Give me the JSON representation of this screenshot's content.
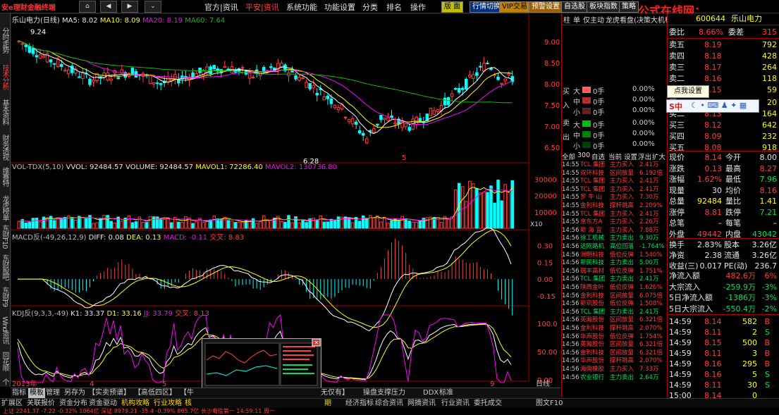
{
  "menu": {
    "logo": "安e理财金融终端",
    "nav_buttons": [
      "⌂",
      "◀",
      "▶",
      "⌄"
    ],
    "items": [
      "官方|资讯",
      "平安|资讯",
      "系统功能",
      "功能设置",
      "分类",
      "排名",
      "操作"
    ],
    "active_item": 1,
    "tool_buttons": [
      "版 面",
      "行情切换",
      "VIP交易",
      "预警设置",
      "自选股",
      "板块指数",
      "策略"
    ],
    "watermark": "公式在线网：www.gszx.com.cn"
  },
  "left_tabs": [
    "分时走势",
    "技术分析",
    "基本资料",
    "财务透视",
    "维赛特",
    "龙虎榜单",
    "东财F10",
    "东财股吧",
    "东财F9",
    "Wind资讯",
    "同花顺",
    "个股"
  ],
  "chart_header": {
    "symbol_title": "乐山电力(日线)",
    "ma5": "MA5: 8.02",
    "ma10": "MA10: 8.09",
    "ma20": "MA20: 8.19",
    "ma60": "MA60: 7.64",
    "price_axis": [
      "9.00",
      "8.50",
      "8.00",
      "7.50",
      "7.00",
      "6.50"
    ],
    "high_label": "9.24",
    "low_label": "6.28",
    "marker": "5"
  },
  "volume_panel": {
    "title": "VOL-TDX(5,10)",
    "vvol": "VVOL: 92484.57",
    "volume": "VOLUME: 92484.57",
    "mavol1": "MAVOL1: 72286.40",
    "mavol2": "MAVOL2: 130736.80",
    "axis": [
      "30000",
      "20000",
      "10000"
    ],
    "unit": "X10"
  },
  "macd_panel": {
    "title": "MACD反(-49,26,12,9)",
    "diff": "DIFF: 0.08",
    "dea": "DEA: 0.13",
    "macd": "MACD: -0.11",
    "cross": "交叉: 8.83",
    "axis": [
      "0.30",
      "0.15",
      "0.00",
      "-0.15"
    ]
  },
  "kdj_panel": {
    "title": "KDJ反(9,3,3,-49)",
    "k": "K1: 33.37",
    "d": "D1: 33.16",
    "jj": "JJ: 33.79",
    "cross": "交叉: 8.13",
    "axis": [
      "100.0",
      "50.00",
      "0.00"
    ]
  },
  "date_axis": {
    "labels": [
      "2013年",
      "4",
      "5",
      "9"
    ],
    "period_label": "日线"
  },
  "bottom_tabs": [
    "指标",
    "模板",
    "管理",
    "另存为",
    "【实卖预谱】",
    "【高低四区】",
    "【牛",
    "无仅有】",
    "操盘支撑压力",
    "DDX",
    "标准"
  ],
  "bottom_tab_active": 1,
  "bottom_bar": [
    "扩展区",
    "关联报价",
    "资金分布",
    "资金驱动",
    "机构攻略",
    "行业攻略",
    "核",
    "期",
    "经济指标",
    "综合资讯",
    "网摘资讯",
    "行业资讯",
    "委托成交",
    "图文F10"
  ],
  "mid_panel": {
    "tabs": [
      "柱",
      "单",
      "仅主动",
      "龙虎看盘(决策大机构)"
    ],
    "buy_label": "买入",
    "sell_label": "卖出",
    "sizes": [
      "大",
      "中",
      "小"
    ],
    "buy_rows": [
      {
        "size": "大",
        "vol": "0手",
        "pct": "0.00%"
      },
      {
        "size": "中",
        "vol": "0手",
        "pct": "0.00%"
      },
      {
        "size": "小",
        "vol": "0手",
        "pct": "0.00%"
      }
    ],
    "sell_rows": [
      {
        "size": "大",
        "vol": "0手",
        "pct": "0.00%"
      },
      {
        "size": "中",
        "vol": "0手",
        "pct": "0.00%"
      },
      {
        "size": "小",
        "vol": "0手",
        "pct": "0.00%"
      }
    ],
    "filter_tabs": [
      "全部",
      "300",
      "自选",
      "当前",
      "设置",
      "浮出",
      "扩大"
    ],
    "trades": [
      {
        "t": "14:55",
        "name": "TCL 集团",
        "act": "主力买入",
        "val": "2.41万",
        "c": "red"
      },
      {
        "t": "14:55",
        "name": "双环科技",
        "act": "区间放量",
        "val": "6.192倍",
        "c": "red"
      },
      {
        "t": "14:55",
        "name": "TCL 集团",
        "act": "主力买入",
        "val": "2.41万",
        "c": "red"
      },
      {
        "t": "14:55",
        "name": "TCL 集团",
        "act": "主力买入",
        "val": "2.41万",
        "c": "red"
      },
      {
        "t": "14:55",
        "name": "罗 牛 山",
        "act": "主力买入",
        "val": "7.30万",
        "c": "red"
      },
      {
        "t": "14:55",
        "name": "金利科技",
        "act": "撑杆跳高",
        "val": "2.209%",
        "c": "red"
      },
      {
        "t": "14:55",
        "name": "TCL 集团",
        "act": "主力买入",
        "val": "2.41万",
        "c": "red"
      },
      {
        "t": "14:55",
        "name": "京东方A",
        "act": "主力买入",
        "val": "2.26万",
        "c": "red"
      },
      {
        "t": "14:56",
        "name": "新 海 宜",
        "act": "主力买入",
        "val": "7.88万",
        "c": "red"
      },
      {
        "t": "14:56",
        "name": "徐工机械",
        "act": "主力卖出",
        "val": "9.30万",
        "c": "green"
      },
      {
        "t": "14:56",
        "name": "达刚路机",
        "act": "高位回落",
        "val": "-1.764%",
        "c": "green"
      },
      {
        "t": "14:56",
        "name": "洲明科技",
        "act": "低位反弹",
        "val": "1.540%",
        "c": "red"
      },
      {
        "t": "14:56",
        "name": "新民科技",
        "act": "主力卖出",
        "val": "5.00万",
        "c": "green"
      },
      {
        "t": "14:56",
        "name": "瑞丰高材",
        "act": "低位反弹",
        "val": "1.751%",
        "c": "red"
      },
      {
        "t": "14:56",
        "name": "TCL 集团",
        "act": "主力卖出",
        "val": "2.41万",
        "c": "green"
      },
      {
        "t": "14:56",
        "name": "陕西金叶",
        "act": "低位反弹",
        "val": "1.626%",
        "c": "red"
      },
      {
        "t": "14:56",
        "name": "金利科技",
        "act": "区间放量",
        "val": "6.075倍",
        "c": "red"
      },
      {
        "t": "14:56",
        "name": "新筑股份",
        "act": "低位反弹",
        "val": "1.508%",
        "c": "red"
      },
      {
        "t": "14:56",
        "name": "TCL 集团",
        "act": "主力卖出",
        "val": "2.41万",
        "c": "green"
      },
      {
        "t": "14:56",
        "name": "英瀚股份",
        "act": "区间放量",
        "val": "6.321倍",
        "c": "red"
      },
      {
        "t": "14:56",
        "name": "金利科技",
        "act": "撑杆跳高",
        "val": "2.070%",
        "c": "red"
      },
      {
        "t": "14:56",
        "name": "华声股份",
        "act": "低位反弹",
        "val": "1.754%",
        "c": "red"
      },
      {
        "t": "14:56",
        "name": "英瀚股份",
        "act": "区间放量",
        "val": "6.321倍",
        "c": "red"
      },
      {
        "t": "14:56",
        "name": "金利科技",
        "act": "区间放量",
        "val": "6.321倍",
        "c": "red"
      },
      {
        "t": "14:56",
        "name": "华声股份",
        "act": "撑杆跳高",
        "val": "2.070%",
        "c": "red"
      },
      {
        "t": "14:56",
        "name": "海南橡胶",
        "act": "主力买入",
        "val": "7.33万",
        "c": "red"
      },
      {
        "t": "14:56",
        "name": "农业银行",
        "act": "主力卖出",
        "val": "2.64万",
        "c": "green"
      }
    ],
    "bottom_tabs": [
      "主力",
      "分布",
      "龙虎",
      "风向"
    ]
  },
  "quote": {
    "code": "600644",
    "name": "乐山电力",
    "weibi_label": "委比",
    "weibi": "8.66%",
    "weicha_label": "委差",
    "weicha": "315",
    "asks": [
      {
        "label": "卖五",
        "price": "8.19",
        "vol": "792"
      },
      {
        "label": "卖四",
        "price": "8.18",
        "vol": "428"
      },
      {
        "label": "卖三",
        "price": "8.17",
        "vol": "264"
      },
      {
        "label": "卖二",
        "price": "8.16",
        "vol": "118"
      },
      {
        "label": "卖一",
        "price": "8.15",
        "vol": "59"
      }
    ],
    "bids": [
      {
        "label": "买一",
        "price": "8.14",
        "vol": "20"
      },
      {
        "label": "买二",
        "price": "8.13",
        "vol": "164"
      },
      {
        "label": "买三",
        "price": "8.12",
        "vol": "642"
      },
      {
        "label": "买四",
        "price": "8.09",
        "vol": "232"
      },
      {
        "label": "买五",
        "price": "8.08",
        "vol": "918"
      }
    ],
    "stats": [
      {
        "l1": "现价",
        "v1": "8.14",
        "c1": "red",
        "l2": "今开",
        "v2": "8.00",
        "c2": "white"
      },
      {
        "l1": "涨跌",
        "v1": "0.13",
        "c1": "red",
        "l2": "最高",
        "v2": "8.27",
        "c2": "red"
      },
      {
        "l1": "涨幅",
        "v1": "1.62%",
        "c1": "red",
        "l2": "最低",
        "v2": "7.96",
        "c2": "green"
      },
      {
        "l1": "现量",
        "v1": "30",
        "c1": "white",
        "l2": "均价",
        "v2": "8.16",
        "c2": "red"
      },
      {
        "l1": "总量",
        "v1": "92484",
        "c1": "yellow",
        "l2": "量比",
        "v2": "1.41",
        "c2": "yellow"
      },
      {
        "l1": "涨停",
        "v1": "8.81",
        "c1": "red",
        "l2": "跌停",
        "v2": "7.21",
        "c2": "green"
      },
      {
        "l1": "总笔",
        "v1": "–",
        "c1": "white",
        "l2": "每笔",
        "v2": "–",
        "c2": "white"
      },
      {
        "l1": "外盘",
        "v1": "49442",
        "c1": "red",
        "l2": "内盘",
        "v2": "43042",
        "c2": "green"
      }
    ],
    "stats2": [
      {
        "l1": "换手",
        "v1": "2.83%",
        "l2": "股本",
        "v2": "3.26亿"
      },
      {
        "l1": "净资",
        "v1": "2.38",
        "l2": "流通",
        "v2": "3.26亿"
      },
      {
        "l1": "收益(三)",
        "v1": "0.017",
        "l2": "PE(动)",
        "v2": "236.7"
      }
    ],
    "flows": [
      {
        "label": "净流入额",
        "val": "482.6万",
        "pct": "6%",
        "c": "red"
      },
      {
        "label": "大宗流入",
        "val": "-259.9万",
        "pct": "-3%",
        "c": "green"
      },
      {
        "label": "5日净流入额",
        "val": "-1386万",
        "pct": "-3%",
        "c": "green"
      },
      {
        "label": "5日大宗流入",
        "val": "-550.4万",
        "pct": "-2%",
        "c": "green"
      }
    ],
    "ticks": [
      {
        "t": "14:59",
        "p": "8.14",
        "v": "582",
        "d": "B",
        "c": "red"
      },
      {
        "t": "14:59",
        "p": "8.11",
        "v": "2",
        "d": "S",
        "c": "green"
      },
      {
        "t": "14:59",
        "p": "8.15",
        "v": "500",
        "d": "B",
        "c": "red"
      },
      {
        "t": "14:59",
        "p": "8.11",
        "v": "3",
        "d": "B",
        "c": "red"
      },
      {
        "t": "14:59",
        "p": "8.16",
        "v": "295",
        "d": "B",
        "c": "red"
      },
      {
        "t": "14:59",
        "p": "8.16",
        "v": "5",
        "d": "S",
        "c": "green"
      },
      {
        "t": "14:59",
        "p": "8.11",
        "v": "30",
        "d": "S",
        "c": "green"
      },
      {
        "t": "15:00",
        "p": "8.14",
        "v": "0",
        "d": "",
        "c": "red"
      }
    ],
    "bottom_tabs": [
      "笔",
      "价",
      "细",
      "盘",
      "势",
      "联",
      "值",
      "主"
    ]
  },
  "tooltip": "点我设置",
  "ime_label": "S中",
  "status": {
    "text": "上证 2241.37 -7.22 -0.32%  1064亿  深证 8979.21 -35.4 -0.39%  865.7亿   长沙电信第一  14:59:11 周一"
  },
  "colors": {
    "up": "#ff3c3c",
    "down": "#00ffff",
    "ma5": "#ffffff",
    "ma10": "#ffff00",
    "ma20": "#ff00ff",
    "ma60": "#00c000"
  }
}
